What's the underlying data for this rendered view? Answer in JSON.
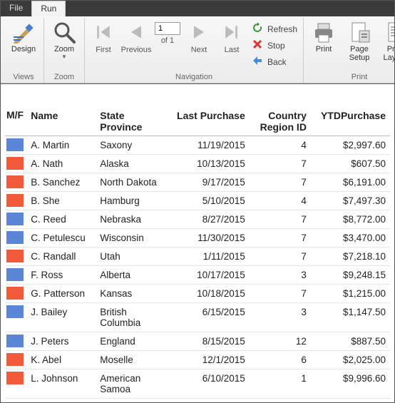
{
  "tabs": {
    "file": "File",
    "run": "Run",
    "active": "run"
  },
  "ribbon": {
    "views": {
      "label": "Views",
      "design": "Design"
    },
    "zoom": {
      "label": "Zoom",
      "zoom": "Zoom"
    },
    "navigation": {
      "label": "Navigation",
      "first": "First",
      "previous": "Previous",
      "next": "Next",
      "last": "Last",
      "page_current": "1",
      "page_of_prefix": "of ",
      "page_total": "1",
      "refresh": "Refresh",
      "stop": "Stop",
      "back": "Back"
    },
    "print": {
      "label": "Print",
      "print": "Print",
      "page_setup": "Page\nSetup",
      "print_layout": "Print\nLayout"
    }
  },
  "columns": {
    "mf": "M/F",
    "name": "Name",
    "state": "State Province",
    "last_purchase": "Last Purchase",
    "country": "Country Region ID",
    "ytd": "YTDPurchase"
  },
  "colors": {
    "male": "#5b85d6",
    "female": "#f15a3b"
  },
  "rows": [
    {
      "mf": "male",
      "name": "A. Martin",
      "state": "Saxony",
      "last_purchase": "11/19/2015",
      "country": "4",
      "ytd": "$2,997.60"
    },
    {
      "mf": "female",
      "name": "A. Nath",
      "state": "Alaska",
      "last_purchase": "10/13/2015",
      "country": "7",
      "ytd": "$607.50"
    },
    {
      "mf": "female",
      "name": "B. Sanchez",
      "state": "North Dakota",
      "last_purchase": "9/17/2015",
      "country": "7",
      "ytd": "$6,191.00"
    },
    {
      "mf": "female",
      "name": "B. She",
      "state": "Hamburg",
      "last_purchase": "5/10/2015",
      "country": "4",
      "ytd": "$7,497.30"
    },
    {
      "mf": "male",
      "name": "C. Reed",
      "state": "Nebraska",
      "last_purchase": "8/27/2015",
      "country": "7",
      "ytd": "$8,772.00"
    },
    {
      "mf": "male",
      "name": "C. Petulescu",
      "state": "Wisconsin",
      "last_purchase": "11/30/2015",
      "country": "7",
      "ytd": "$3,470.00"
    },
    {
      "mf": "female",
      "name": "C. Randall",
      "state": "Utah",
      "last_purchase": "1/11/2015",
      "country": "7",
      "ytd": "$7,218.10"
    },
    {
      "mf": "male",
      "name": "F. Ross",
      "state": "Alberta",
      "last_purchase": "10/17/2015",
      "country": "3",
      "ytd": "$9,248.15"
    },
    {
      "mf": "female",
      "name": "G. Patterson",
      "state": "Kansas",
      "last_purchase": "10/18/2015",
      "country": "7",
      "ytd": "$1,215.00"
    },
    {
      "mf": "male",
      "name": "J. Bailey",
      "state": "British Columbia",
      "last_purchase": "6/15/2015",
      "country": "3",
      "ytd": "$1,147.50"
    },
    {
      "mf": "male",
      "name": "J. Peters",
      "state": "England",
      "last_purchase": "8/15/2015",
      "country": "12",
      "ytd": "$887.50"
    },
    {
      "mf": "female",
      "name": "K. Abel",
      "state": "Moselle",
      "last_purchase": "12/1/2015",
      "country": "6",
      "ytd": "$2,025.00"
    },
    {
      "mf": "female",
      "name": "L. Johnson",
      "state": "American Samoa",
      "last_purchase": "6/10/2015",
      "country": "1",
      "ytd": "$9,996.60"
    }
  ]
}
